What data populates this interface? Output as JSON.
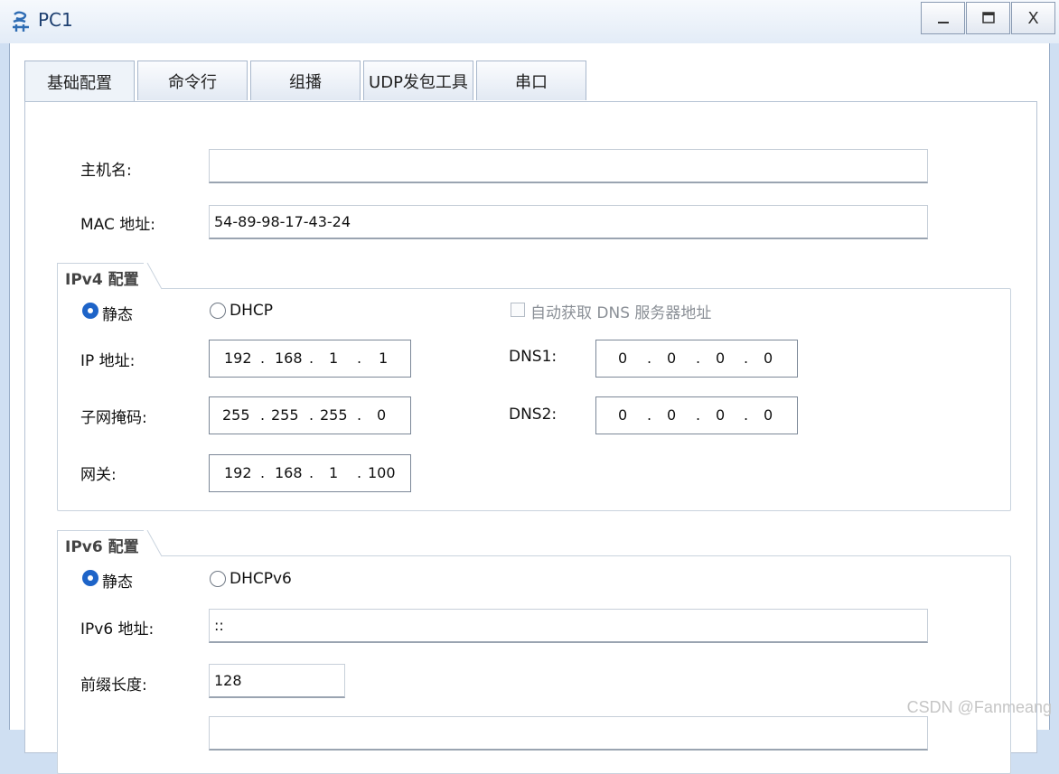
{
  "window": {
    "title": "PC1",
    "min": "—",
    "max": "□",
    "close": "X"
  },
  "tabs": [
    "基础配置",
    "命令行",
    "组播",
    "UDP发包工具",
    "串口"
  ],
  "form": {
    "hostname_label": "主机名:",
    "hostname_value": "",
    "mac_label": "MAC 地址:",
    "mac_value": "54-89-98-17-43-24"
  },
  "ipv4": {
    "group_title": "IPv4 配置",
    "static_label": "静态",
    "dhcp_label": "DHCP",
    "auto_dns_label": "自动获取 DNS 服务器地址",
    "ip_label": "IP 地址:",
    "ip": [
      "192",
      "168",
      "1",
      "1"
    ],
    "mask_label": "子网掩码:",
    "mask": [
      "255",
      "255",
      "255",
      "0"
    ],
    "gateway_label": "网关:",
    "gateway": [
      "192",
      "168",
      "1",
      "100"
    ],
    "dns1_label": "DNS1:",
    "dns1": [
      "0",
      "0",
      "0",
      "0"
    ],
    "dns2_label": "DNS2:",
    "dns2": [
      "0",
      "0",
      "0",
      "0"
    ],
    "dot": "."
  },
  "ipv6": {
    "group_title": "IPv6 配置",
    "static_label": "静态",
    "dhcp_label": "DHCPv6",
    "ip_label": "IPv6 地址:",
    "ip_value": "::",
    "prefix_label": "前缀长度:",
    "prefix_value": "128"
  },
  "watermark": "CSDN @Fanmeang",
  "colors": {
    "accent": "#1e64c8",
    "titlebar": "#e3ecf7",
    "frame": "#cfdff2"
  }
}
